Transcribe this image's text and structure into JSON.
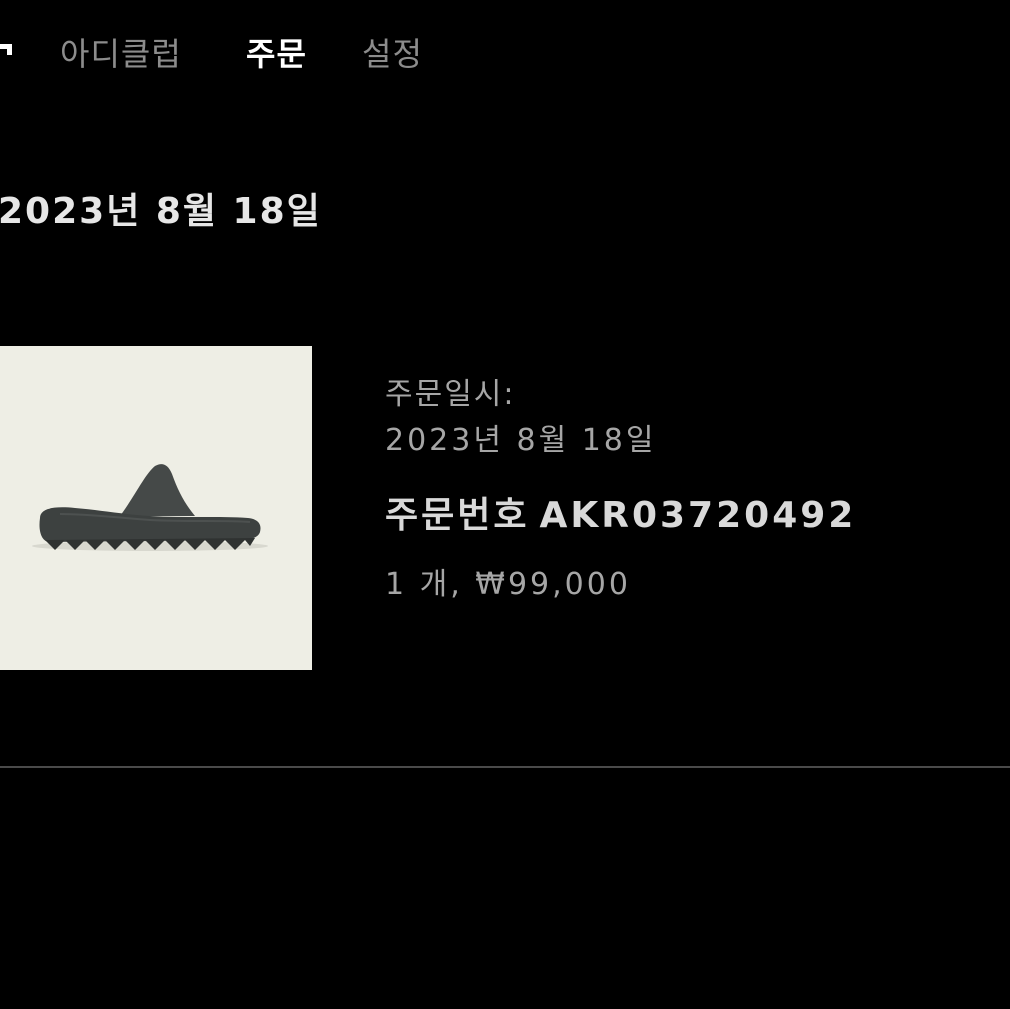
{
  "tabs": {
    "adiclub": "아디클럽",
    "orders": "주문",
    "settings": "설정"
  },
  "order": {
    "date_heading": "2023년 8월 18일",
    "order_date_label": "주문일시:",
    "order_date_value": "2023년 8월 18일",
    "order_number_label": "주문번호",
    "order_number_value": "AKR03720492",
    "summary": "1 개, ₩99,000"
  },
  "product": {
    "image_icon": "slide-sandal-image",
    "image_background": "#eeeee5",
    "shoe_color": "#3d4140"
  },
  "colors": {
    "background": "#000000",
    "text_primary": "#ffffff",
    "text_muted": "#8c8c8c",
    "divider": "#4a4a4a"
  }
}
